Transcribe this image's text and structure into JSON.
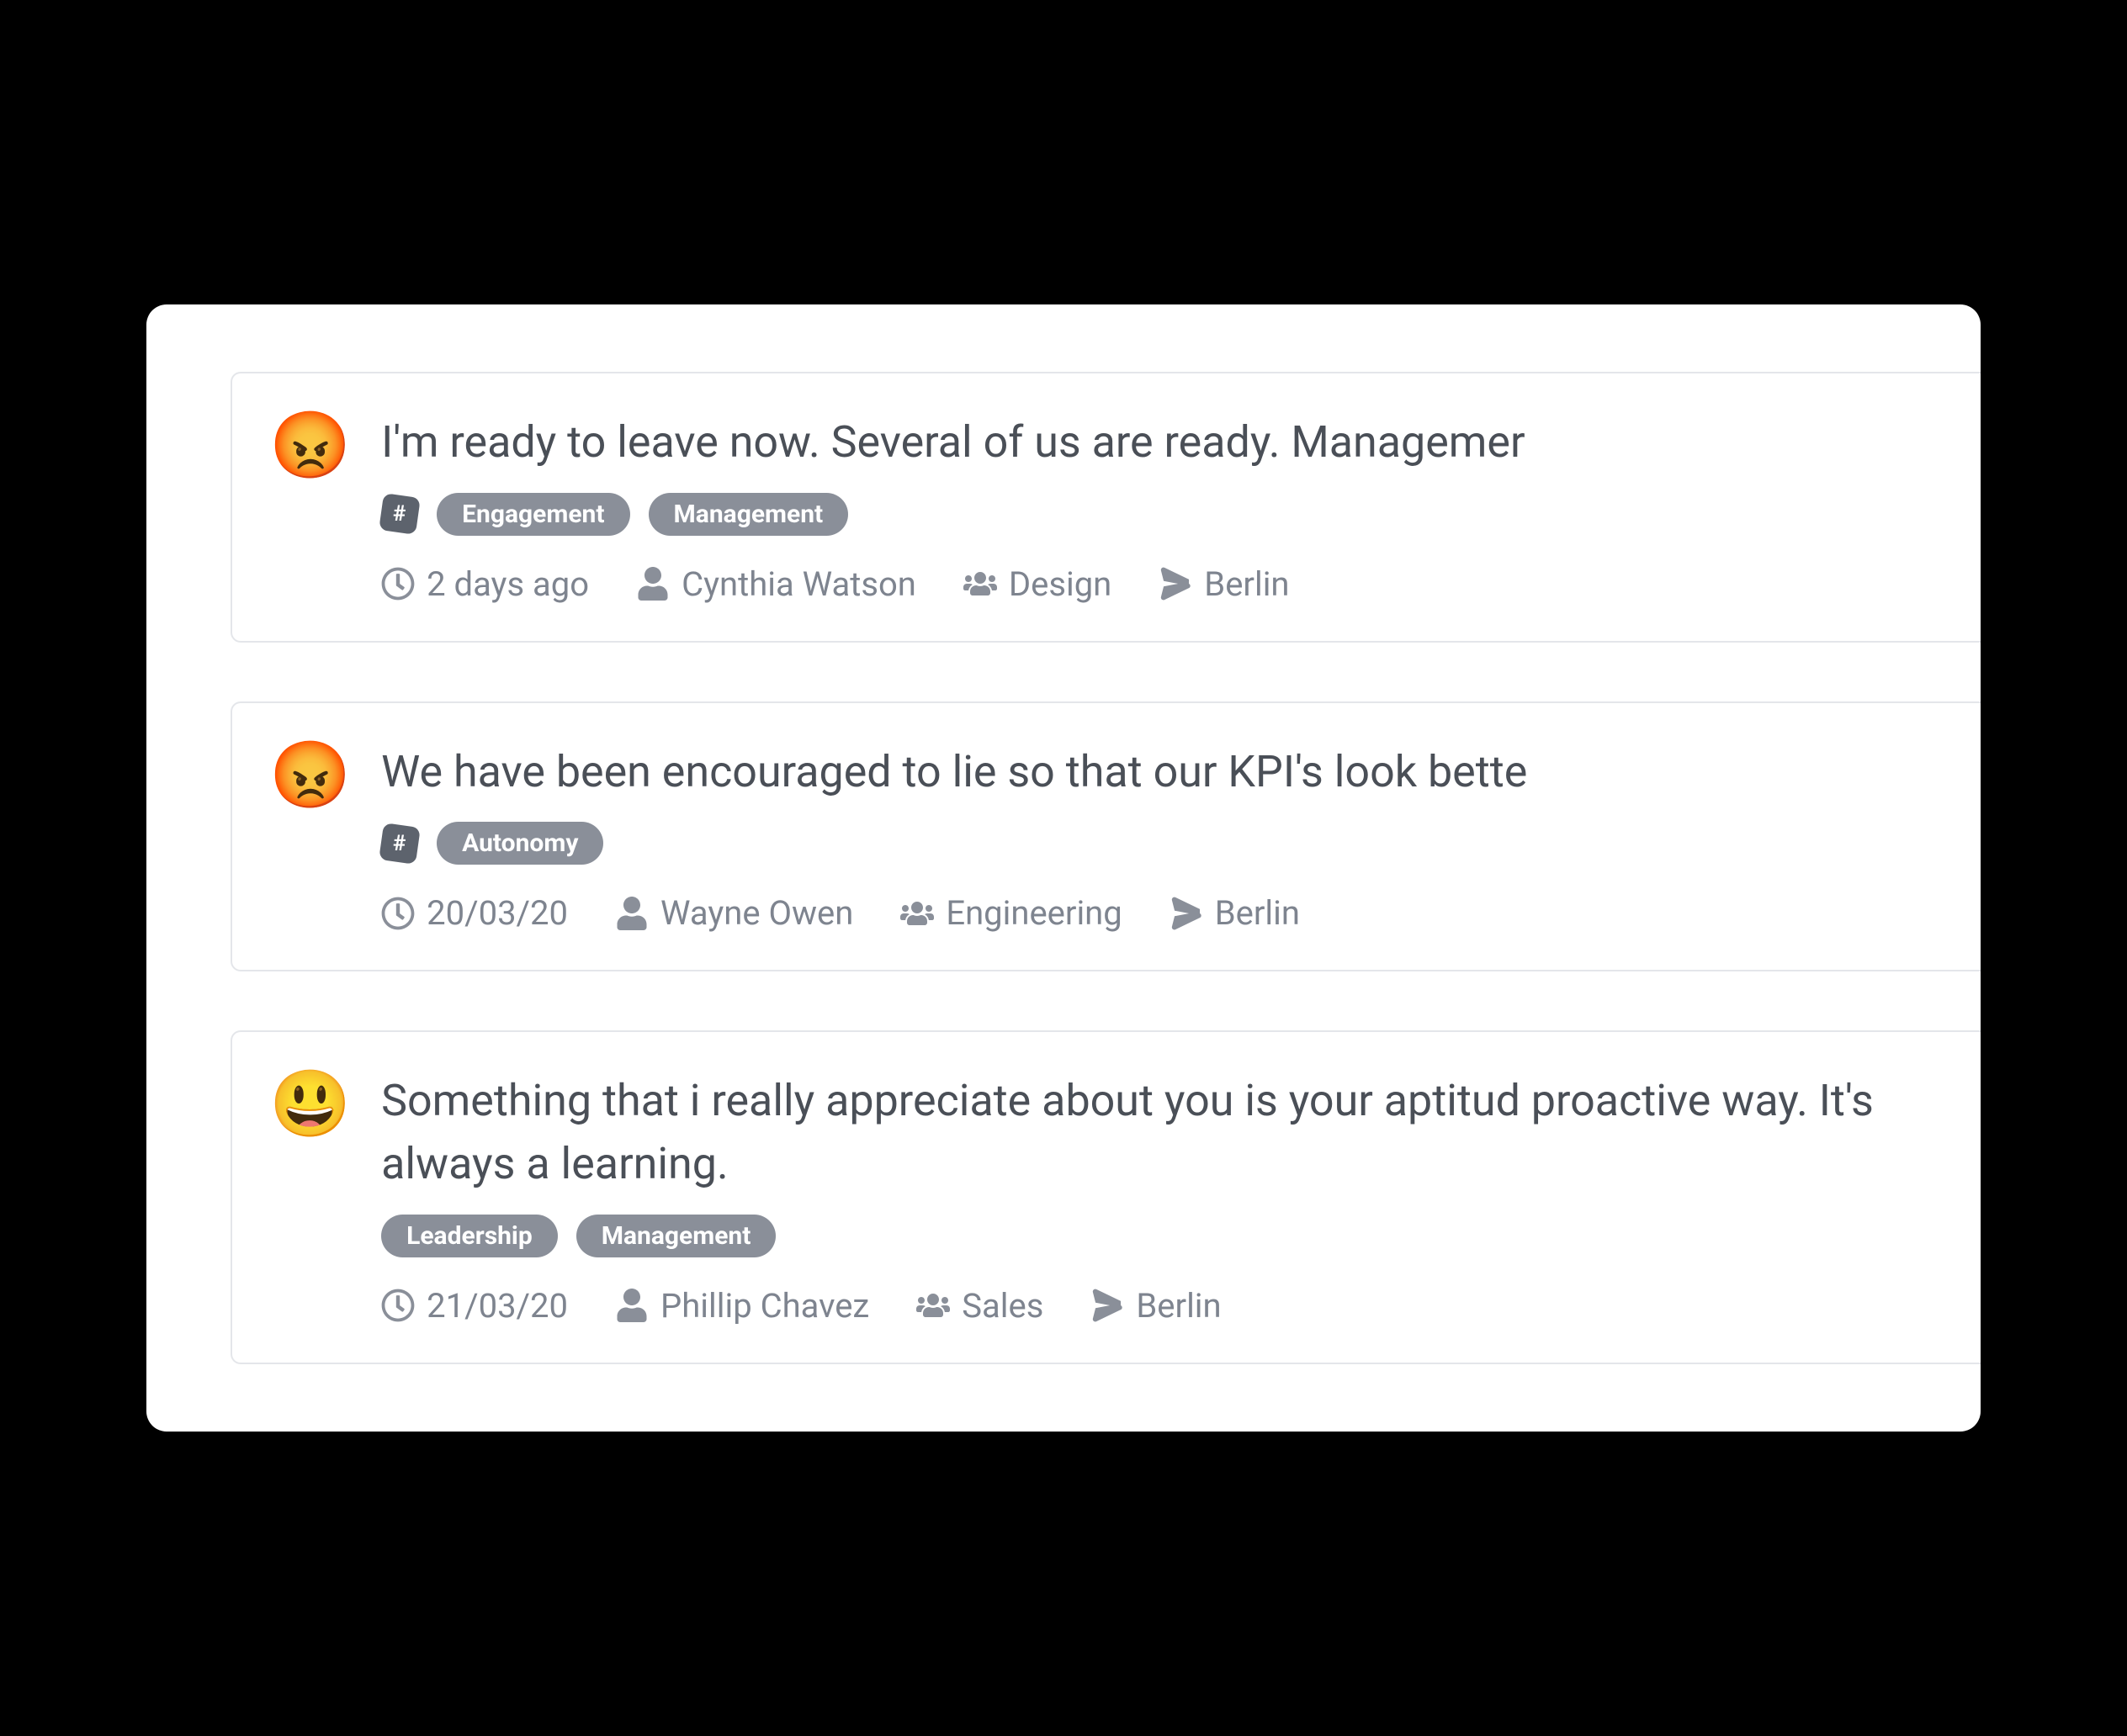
{
  "feedback": [
    {
      "emoji": "😡",
      "message": "I'm ready to leave now. Several of us are ready. Managemer",
      "wrap": false,
      "hash": true,
      "tags": [
        "Engagement",
        "Management"
      ],
      "date": "2 days ago",
      "author": "Cynthia Watson",
      "team": "Design",
      "location": "Berlin"
    },
    {
      "emoji": "😡",
      "message": "We have been encouraged to lie so that our KPI's look bette",
      "wrap": false,
      "hash": true,
      "tags": [
        "Autonomy"
      ],
      "date": "20/03/20",
      "author": "Wayne Owen",
      "team": "Engineering",
      "location": "Berlin"
    },
    {
      "emoji": "😃",
      "message": "Something that i really appreciate about you is your aptitud proactive way. It's always a learning.",
      "wrap": true,
      "hash": false,
      "tags": [
        "Leadership",
        "Management"
      ],
      "date": "21/03/20",
      "author": "Phillip Chavez",
      "team": "Sales",
      "location": "Berlin"
    }
  ]
}
